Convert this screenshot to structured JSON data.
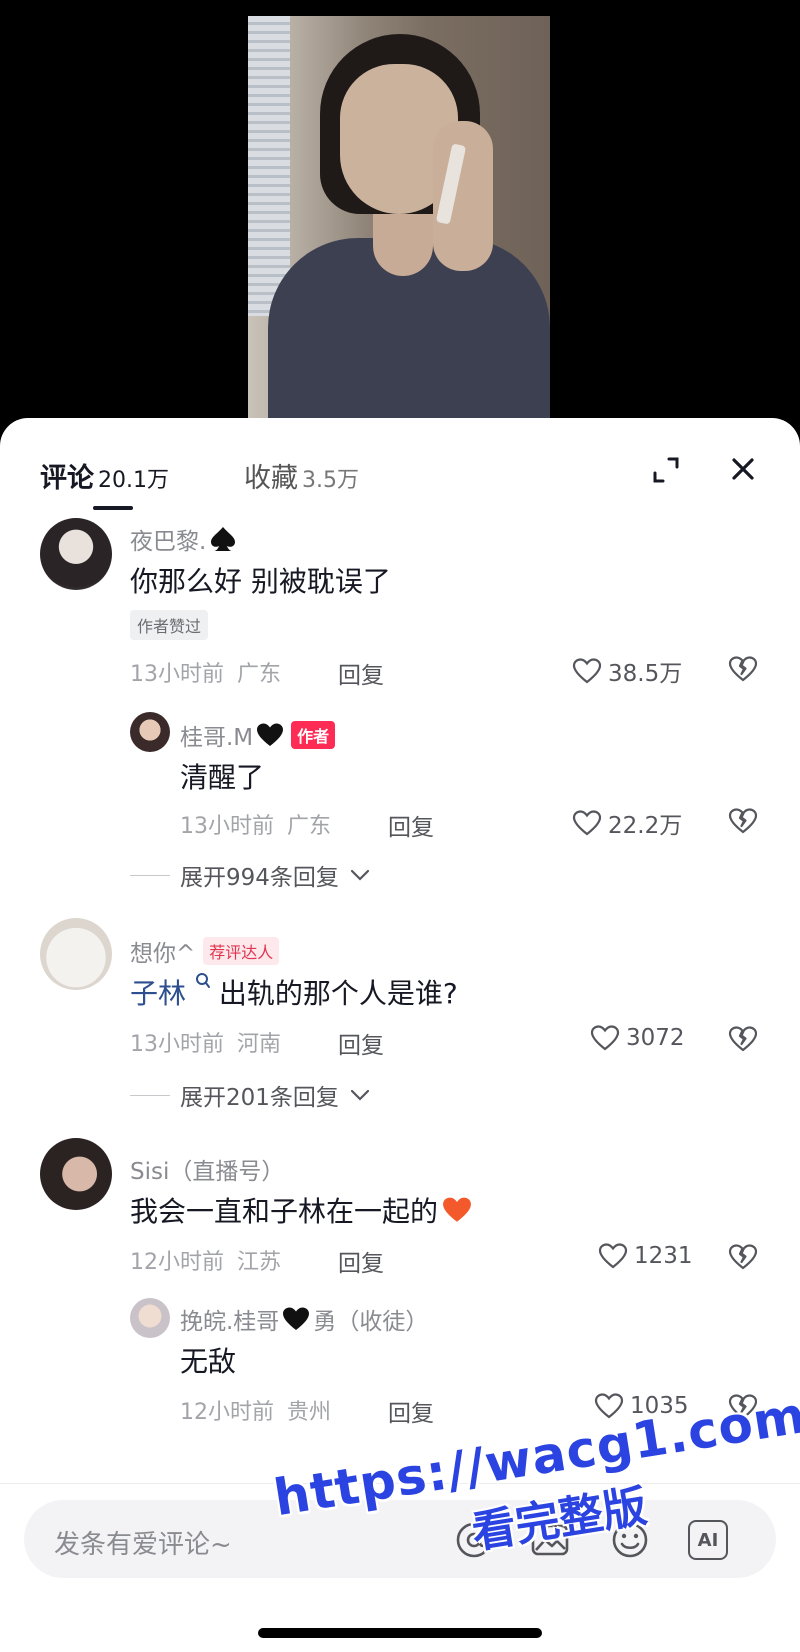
{
  "tabs": {
    "comments_label": "评论",
    "comments_count": "20.1万",
    "favorites_label": "收藏",
    "favorites_count": "3.5万"
  },
  "comments": [
    {
      "username": "夜巴黎.",
      "name_suffix_icon": "spade-icon",
      "text": "你那么好 别被耽误了",
      "author_liked_tag": "作者赞过",
      "time": "13小时前",
      "location": "广东",
      "reply_label": "回复",
      "likes": "38.5万",
      "replies": [
        {
          "username": "桂哥.M",
          "name_suffix_icon": "black-heart-icon",
          "badge": "作者",
          "text": "清醒了",
          "time": "13小时前",
          "location": "广东",
          "reply_label": "回复",
          "likes": "22.2万"
        }
      ],
      "expand_label": "展开994条回复"
    },
    {
      "username": "想你^",
      "badge": "荐评达人",
      "mention": "子林",
      "text": "出轨的那个人是谁?",
      "time": "13小时前",
      "location": "河南",
      "reply_label": "回复",
      "likes": "3072",
      "expand_label": "展开201条回复"
    },
    {
      "username": "Sisi（直播号）",
      "text": "我会一直和子林在一起的",
      "text_suffix_icon": "orange-heart-icon",
      "time": "12小时前",
      "location": "江苏",
      "reply_label": "回复",
      "likes": "1231",
      "replies": [
        {
          "username": "挽皖.桂哥",
          "name_mid_icon": "black-heart-icon",
          "username_tail": "勇（收徒）",
          "text": "无敌",
          "time": "12小时前",
          "location": "贵州",
          "reply_label": "回复",
          "likes": "1035"
        }
      ]
    }
  ],
  "input": {
    "placeholder": "发条有爱评论~",
    "ai_label": "AI"
  },
  "watermark": {
    "url": "https://wacg1.com",
    "subtitle": "看完整版"
  },
  "colors": {
    "accent_red": "#fe2c55",
    "text_primary": "#161823",
    "text_secondary": "#8a8b91",
    "watermark_blue": "#2b43e0"
  }
}
